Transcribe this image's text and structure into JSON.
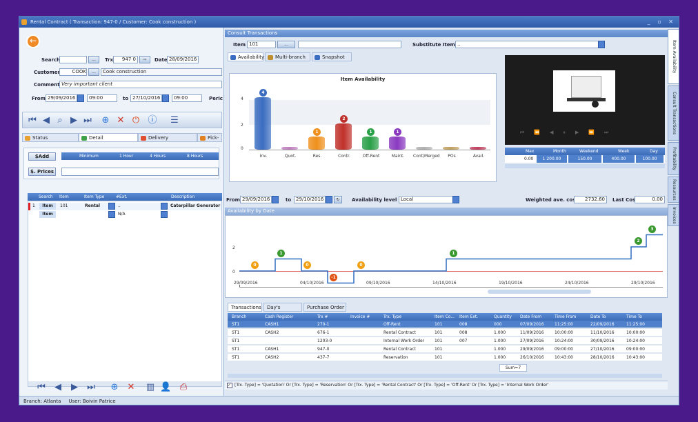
{
  "window_title": "Rental Contract ( Transaction: 947-0 / Customer: Cook construction )",
  "left": {
    "search_label": "Search",
    "trx_label": "Trx",
    "trx_value": "947",
    "trx_suffix": "0",
    "date_label": "Date",
    "date_value": "28/09/2016",
    "customer_label": "Customer",
    "customer_code": "COOK",
    "customer_name": "Cook construction",
    "comment_label": "Comment",
    "comment_value": "Very important client",
    "from_label": "From",
    "from_date": "29/09/2016",
    "from_time": "09:00",
    "to_label": "to",
    "to_date": "27/10/2016",
    "to_time": "09:00",
    "peri_label": "Peric",
    "tabs": [
      "Status",
      "Detail",
      "Delivery",
      "Pick-"
    ],
    "add_btn": "$Add",
    "prices_btn": "$. Prices",
    "rate_headers": [
      "Minimum",
      "1 Hour",
      "4 Hours",
      "8 Hours"
    ],
    "grid_headers": [
      "Search",
      "Item",
      "Item Type",
      "#Ext.",
      "Description"
    ],
    "row1": {
      "num": "1",
      "search": "Item",
      "item": "101",
      "type": "Rental",
      "ext": "..",
      "desc": "Caterpillar Generator X"
    },
    "row2": {
      "search": "Item",
      "ext": "N/A"
    }
  },
  "consult": {
    "title": "Consult Transactions",
    "item_label": "Item",
    "item_value": "101",
    "subst_label": "Substitute Items",
    "subst_value": "..",
    "tabs": [
      "Availability",
      "Multi-branch",
      "Snapshot"
    ]
  },
  "chart_data": [
    {
      "type": "bar",
      "title": "Item Availability",
      "categories": [
        "Inv.",
        "Quot.",
        "Res.",
        "Contr.",
        "Off-Rent",
        "Maint.",
        "Cont/Merged",
        "POs",
        "Avail."
      ],
      "values": [
        4,
        0,
        1,
        2,
        1,
        1,
        0,
        0,
        0
      ],
      "ylim": [
        0,
        4
      ],
      "yticks": [
        "4",
        "2",
        "0"
      ],
      "colors": [
        "#3a6cc0",
        "#c080c0",
        "#f0901c",
        "#c0302a",
        "#2aa048",
        "#8a3ac0",
        "#b0b0b0",
        "#c0a060",
        "#c04060"
      ]
    },
    {
      "type": "line",
      "title": "Availability by Date",
      "x": [
        "29/09/2016",
        "04/10/2016",
        "09/10/2016",
        "14/10/2016",
        "19/10/2016",
        "24/10/2016",
        "29/10/2016"
      ],
      "yticks": [
        "2",
        "0"
      ],
      "badges": [
        "0",
        "1",
        "0",
        "-1",
        "0",
        "1",
        "2",
        "3"
      ]
    }
  ],
  "avail": {
    "from_label": "From",
    "from_date": "29/09/2016",
    "to_label": "to",
    "to_date": "29/10/2016",
    "level_label": "Availability level",
    "level_value": "Local",
    "wac_label": "Weighted ave. cost",
    "wac_value": "2732.60",
    "last_label": "Last Cost",
    "last_value": "0.00",
    "rate_headers": [
      "Max",
      "Month",
      "Weekend",
      "Week",
      "Day"
    ],
    "rate_values": [
      "0.00",
      "1 200.00",
      "150.00",
      "400.00",
      "100.00"
    ]
  },
  "trans": {
    "tabs": [
      "Transactions",
      "Day's conflicts",
      "Purchase Order"
    ],
    "headers": [
      "Branch",
      "Cash Register",
      "Trx #",
      "Invoice #",
      "Trx. Type",
      "Item Co...",
      "Item Ext.",
      "Quantity",
      "Date From",
      "Time From",
      "Date To",
      "Time To"
    ],
    "rows": [
      [
        "ST1",
        "CASH1",
        "270-1",
        "",
        "Off-Rent",
        "101",
        "008",
        "000",
        "07/09/2016",
        "11:25:00",
        "22/09/2016",
        "11:25:00"
      ],
      [
        "ST1",
        "CASH2",
        "676-1",
        "",
        "Rental Contract",
        "101",
        "008",
        "1.000",
        "11/09/2016",
        "10:00:00",
        "11/10/2016",
        "10:00:00"
      ],
      [
        "ST1",
        "",
        "1203-0",
        "",
        "Internal Work Order",
        "101",
        "007",
        "1.000",
        "27/09/2016",
        "10:24:00",
        "30/09/2016",
        "10:24:00"
      ],
      [
        "ST1",
        "CASH1",
        "947-0",
        "",
        "Rental Contract",
        "101",
        "",
        "1.000",
        "29/09/2016",
        "09:00:00",
        "27/10/2016",
        "09:00:00"
      ],
      [
        "ST1",
        "CASH2",
        "437-7",
        "",
        "Reservation",
        "101",
        "",
        "1.000",
        "26/10/2016",
        "10:43:00",
        "28/10/2016",
        "10:43:00"
      ]
    ],
    "sum": "Sum=7",
    "filter": "[Trx. Type] = 'Quotation' Or [Trx. Type] = 'Reservation' Or [Trx. Type] = 'Rental Contract' Or [Trx. Type] = 'Off-Rent' Or [Trx. Type] = 'Internal Work Order'"
  },
  "side_tabs": [
    "Item Availability",
    "Consult Transactions",
    "Profitability",
    "Resources",
    "Invoices"
  ],
  "status": {
    "branch": "Branch: Atlanta",
    "user": "User: Boivin Patrice"
  }
}
